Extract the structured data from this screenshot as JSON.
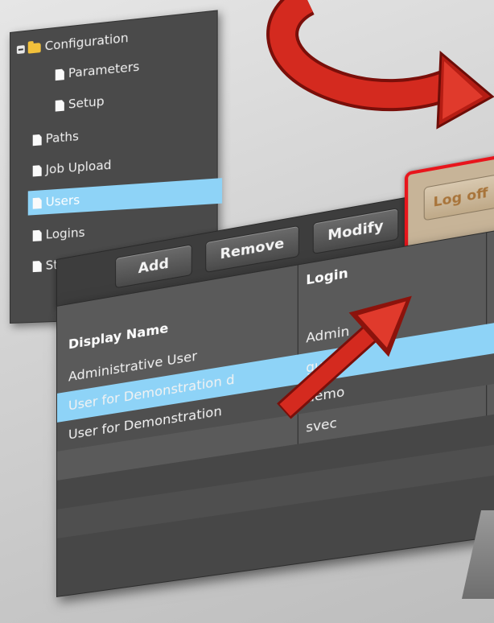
{
  "tree": {
    "items": [
      {
        "label": "Configuration",
        "icon": "folder-icon",
        "expanded": true,
        "indent": 0
      },
      {
        "label": "Parameters",
        "icon": "page-icon",
        "indent": 1
      },
      {
        "label": "Setup",
        "icon": "page-icon",
        "indent": 1
      },
      {
        "label": "Paths",
        "icon": "page-icon",
        "indent": 0
      },
      {
        "label": "Job Upload",
        "icon": "page-icon",
        "indent": 0
      },
      {
        "label": "Users",
        "icon": "page-icon",
        "indent": 0,
        "selected": true
      },
      {
        "label": "Logins",
        "icon": "page-icon",
        "indent": 0
      },
      {
        "label": "Stackup Templates",
        "icon": "page-icon",
        "indent": 0
      }
    ]
  },
  "toolbar": {
    "add_label": "Add",
    "remove_label": "Remove",
    "modify_label": "Modify",
    "logoff_label": "Log off"
  },
  "table": {
    "columns": [
      "Display Name",
      "Login"
    ],
    "rows": [
      {
        "display_name": "Administrative User",
        "login": "Admin",
        "selected": false
      },
      {
        "display_name": "User for Demonstration d",
        "login": "guest",
        "selected": true
      },
      {
        "display_name": "User for Demonstration",
        "login": "demo",
        "selected": false
      },
      {
        "display_name": "",
        "login": "svec",
        "selected": false
      }
    ]
  },
  "colors": {
    "selection": "#8ed3f7",
    "highlight_border": "#e8151c",
    "arrow_red": "#d42a1f",
    "panel_dark": "#4a4a4a"
  }
}
